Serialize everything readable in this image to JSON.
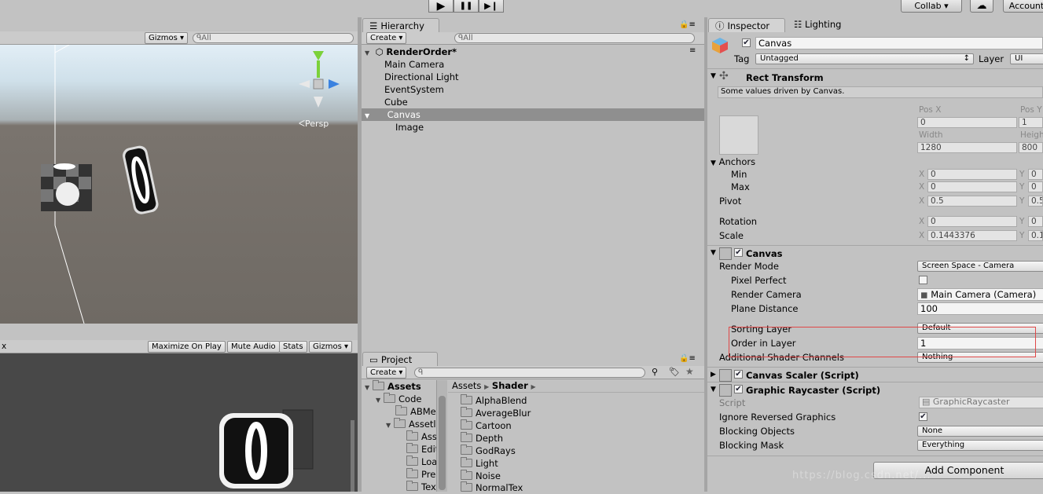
{
  "toolbar": {
    "play": "▶",
    "pause": "❚❚",
    "step": "▶❙",
    "collab": "Collab ▾",
    "account": "Account",
    "cloud": "☁"
  },
  "scene": {
    "gizmos": "Gizmos ▾",
    "search_placeholder": "ᑫAll",
    "persp": "Persp"
  },
  "game": {
    "tab_fragment": "x",
    "maximize": "Maximize On Play",
    "mute": "Mute Audio",
    "stats": "Stats",
    "gizmos": "Gizmos ▾"
  },
  "hierarchy": {
    "tab": "Hierarchy",
    "create": "Create ▾",
    "search_placeholder": "ᑫAll",
    "scene_name": "RenderOrder*",
    "items": [
      "Main Camera",
      "Directional Light",
      "EventSystem",
      "Cube",
      "Canvas",
      "Image"
    ]
  },
  "project": {
    "tab": "Project",
    "create": "Create ▾",
    "tree": [
      "Assets",
      "Code",
      "ABMe",
      "Assetl",
      "Ass",
      "Edit",
      "Loa",
      "Pre",
      "Tex"
    ],
    "breadcrumb": [
      "Assets",
      "Shader"
    ],
    "folders": [
      "AlphaBlend",
      "AverageBlur",
      "Cartoon",
      "Depth",
      "GodRays",
      "Light",
      "Noise",
      "NormalTex"
    ]
  },
  "inspector": {
    "tab": "Inspector",
    "lighting_tab": "Lighting",
    "object_name": "Canvas",
    "tag_label": "Tag",
    "tag_value": "Untagged",
    "layer_label": "Layer",
    "layer_value": "UI",
    "rect": {
      "title": "Rect Transform",
      "note": "Some values driven by Canvas.",
      "posx_label": "Pos X",
      "posy_label": "Pos Y",
      "posx": "0",
      "posy": "1",
      "width_label": "Width",
      "height_label": "Heigh",
      "width": "1280",
      "height": "800",
      "anchors": "Anchors",
      "min": "Min",
      "max": "Max",
      "pivot": "Pivot",
      "rotation": "Rotation",
      "scale": "Scale",
      "x": "X",
      "y": "Y",
      "min_x": "0",
      "min_y": "0",
      "max_x": "0",
      "max_y": "0",
      "pivot_x": "0.5",
      "pivot_y": "0.5",
      "rot_x": "0",
      "rot_y": "0",
      "scale_x": "0.1443376",
      "scale_y": "0.1"
    },
    "canvas": {
      "title": "Canvas",
      "render_mode_label": "Render Mode",
      "render_mode": "Screen Space - Camera",
      "pixel_perfect": "Pixel Perfect",
      "render_camera_label": "Render Camera",
      "render_camera": "Main Camera (Camera)",
      "plane_distance_label": "Plane Distance",
      "plane_distance": "100",
      "sorting_layer_label": "Sorting Layer",
      "sorting_layer": "Default",
      "order_label": "Order in Layer",
      "order": "1",
      "shader_channels_label": "Additional Shader Channels",
      "shader_channels": "Nothing"
    },
    "scaler": {
      "title": "Canvas Scaler (Script)"
    },
    "raycaster": {
      "title": "Graphic Raycaster (Script)",
      "script_label": "Script",
      "script_value": "GraphicRaycaster",
      "ignore_label": "Ignore Reversed Graphics",
      "blocking_objects_label": "Blocking Objects",
      "blocking_objects": "None",
      "blocking_mask_label": "Blocking Mask",
      "blocking_mask": "Everything"
    },
    "add_component": "Add Component",
    "watermark": "https://blog.csdn.net/..."
  },
  "colors": {
    "highlight": "#e04848",
    "selection": "#8f8f8f",
    "sky": "#cfe2ee",
    "ground": "#6f6a64"
  }
}
